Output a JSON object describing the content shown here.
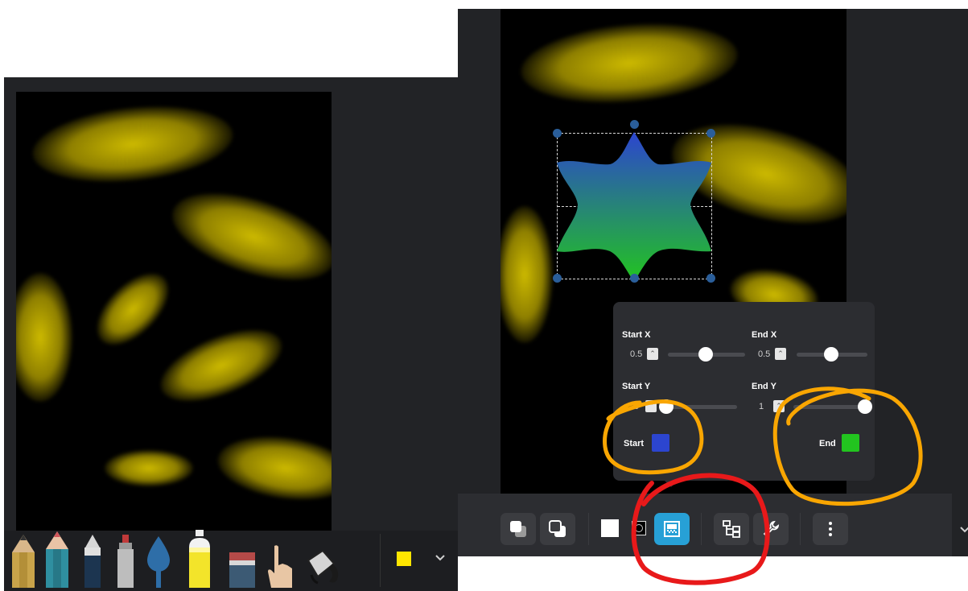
{
  "left_app": {
    "tools": [
      {
        "icon": "pencil-icon"
      },
      {
        "icon": "colored-pencil-icon"
      },
      {
        "icon": "ink-pen-icon"
      },
      {
        "icon": "marker-icon"
      },
      {
        "icon": "water-drop-icon"
      },
      {
        "icon": "spray-can-icon"
      },
      {
        "icon": "eraser-icon"
      },
      {
        "icon": "finger-smudge-icon"
      },
      {
        "icon": "fill-bucket-icon"
      }
    ],
    "current_color": "#ffe600",
    "expand_icon": "chevron-down-icon"
  },
  "right_app": {
    "gradient_popover": {
      "start_x_label": "Start X",
      "start_x_value": "0.5",
      "end_x_label": "End X",
      "end_x_value": "0.5",
      "start_y_label": "Start Y",
      "start_y_value": "0",
      "end_y_label": "End Y",
      "end_y_value": "1",
      "start_color_label": "Start",
      "start_color": "#2c45cf",
      "end_color_label": "End",
      "end_color": "#22c41f",
      "slider_fractions": {
        "start_x": 0.5,
        "end_x": 0.5,
        "start_y": 0,
        "end_y": 1
      }
    },
    "toolbar": {
      "buttons": [
        {
          "icon": "bring-forward-icon"
        },
        {
          "icon": "send-backward-icon"
        },
        {
          "icon": "fill-white-icon"
        },
        {
          "icon": "stroke-icon"
        },
        {
          "icon": "gradient-icon",
          "active": true
        },
        {
          "icon": "hierarchy-icon"
        },
        {
          "icon": "wrench-icon"
        },
        {
          "icon": "more-vertical-icon"
        }
      ]
    }
  },
  "annotation_colors": {
    "orange": "#f9a602",
    "red": "#e8191a"
  }
}
